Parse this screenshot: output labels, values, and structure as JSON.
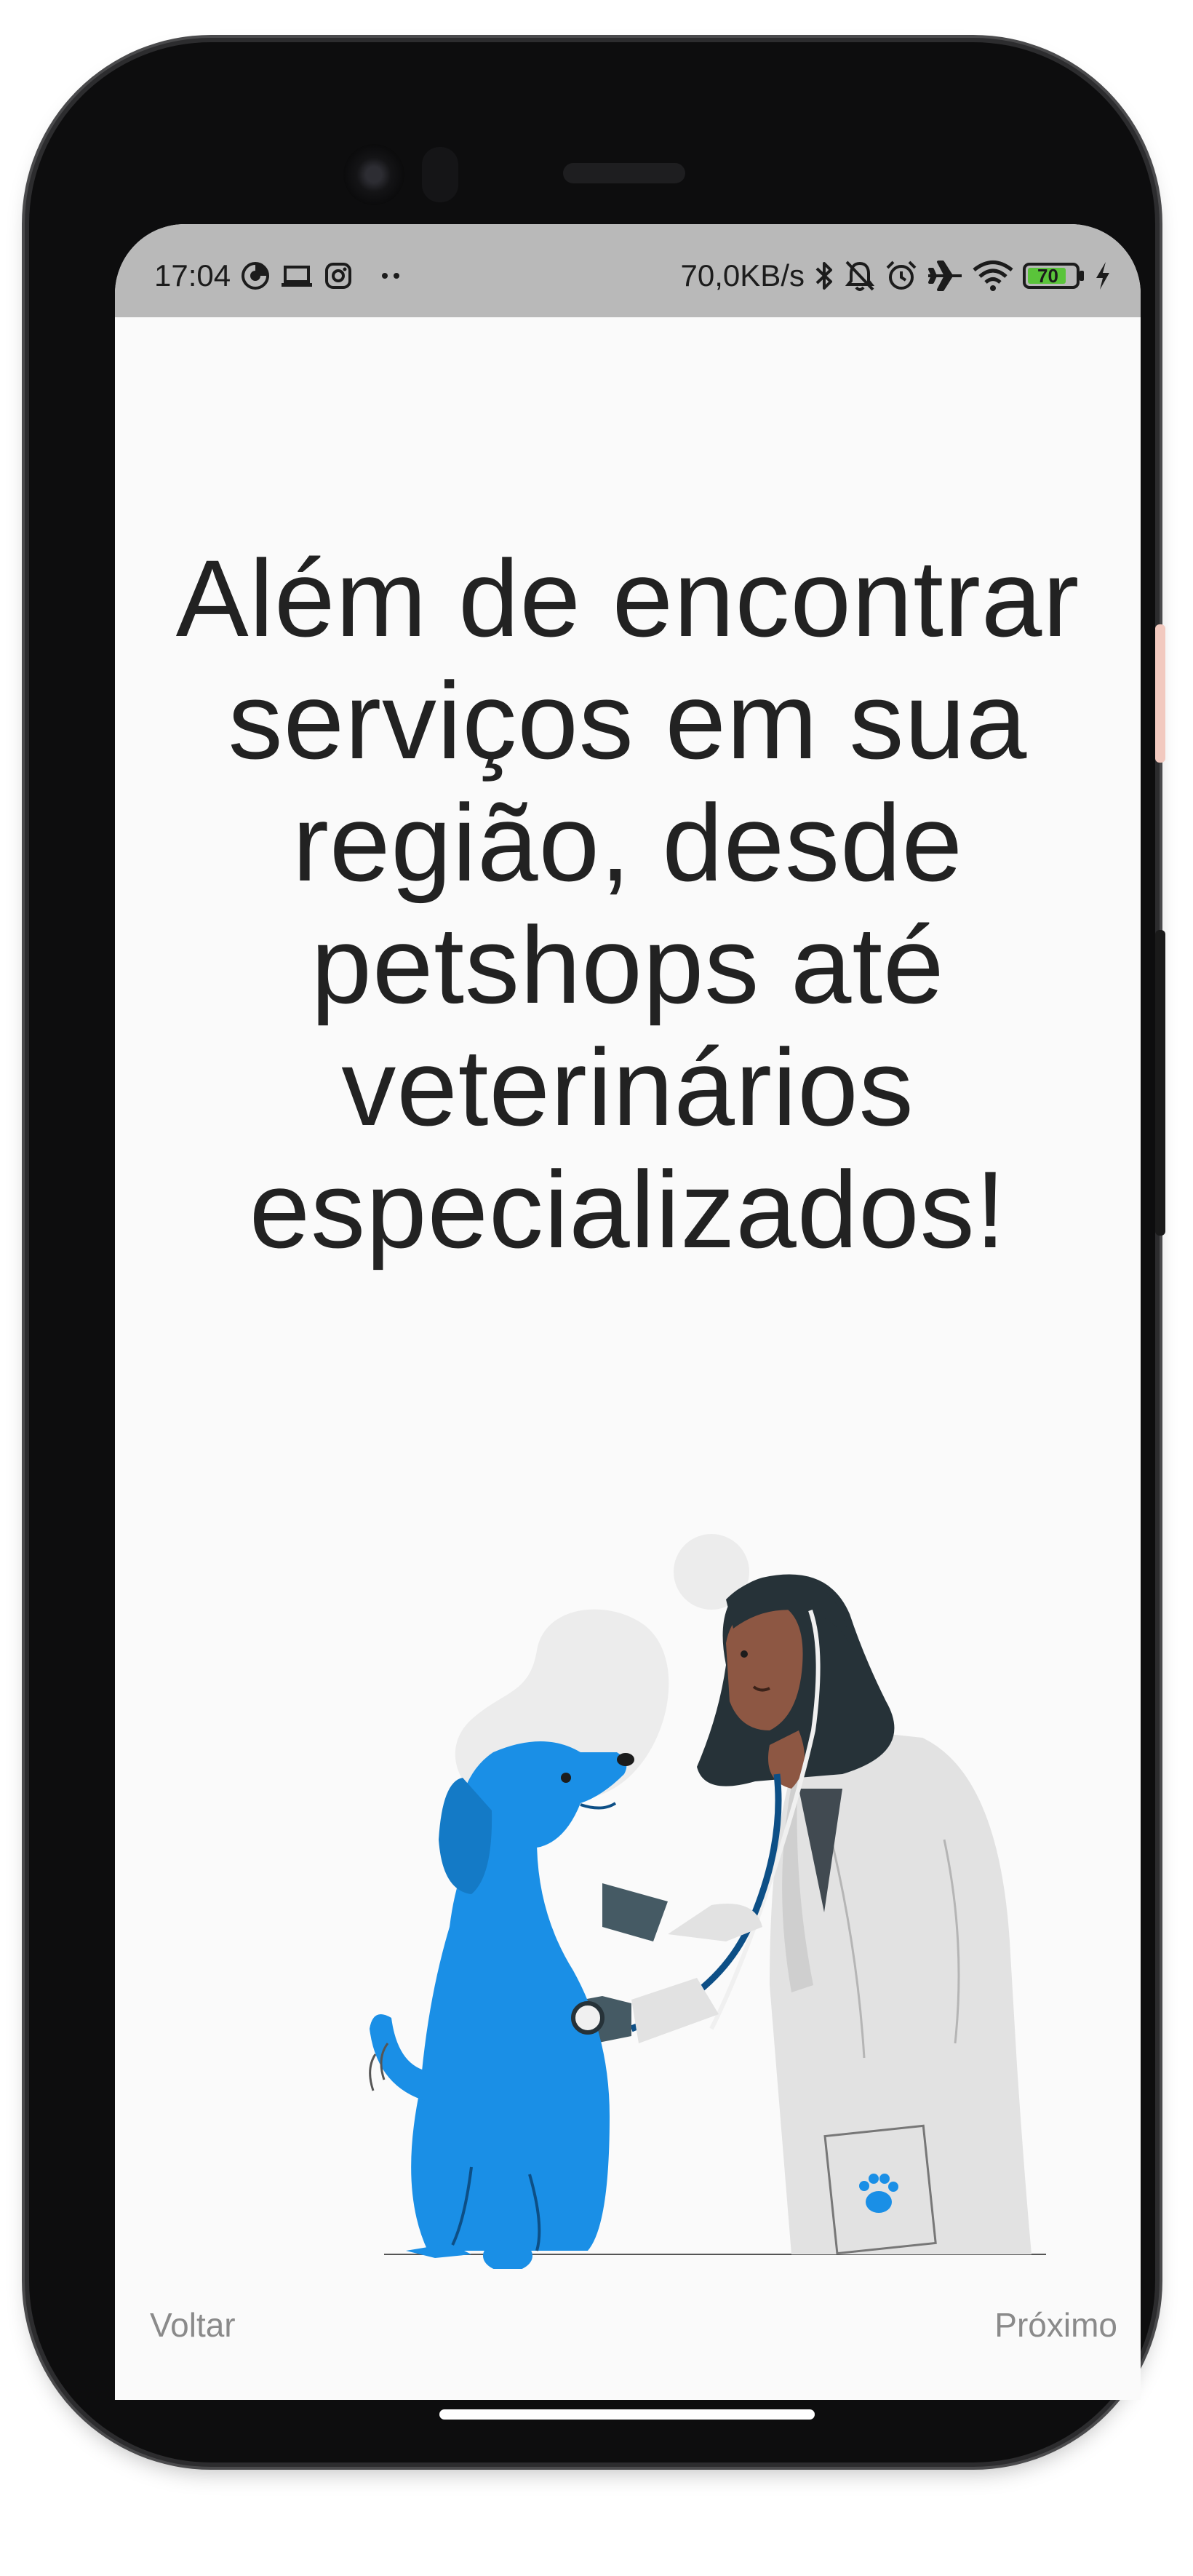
{
  "status_bar": {
    "time": "17:04",
    "left_icons": [
      "data-saver-icon",
      "laptop-icon",
      "instagram-icon",
      "more-notifications-icon"
    ],
    "network_speed": "70,0KB/s",
    "right_icons": [
      "bluetooth-icon",
      "bell-off-icon",
      "alarm-icon",
      "airplane-icon",
      "wifi-icon"
    ],
    "battery_level": "70",
    "battery_color": "#5ac43a",
    "charging_icon": "bolt-icon"
  },
  "onboarding": {
    "headline": "Além de encontrar serviços em sua região, desde petshops até veterinários especializados!",
    "illustration": "veterinarian-examining-dog-illustration",
    "accent_color": "#1a8fe6"
  },
  "navigation": {
    "back_label": "Voltar",
    "next_label": "Próximo"
  }
}
